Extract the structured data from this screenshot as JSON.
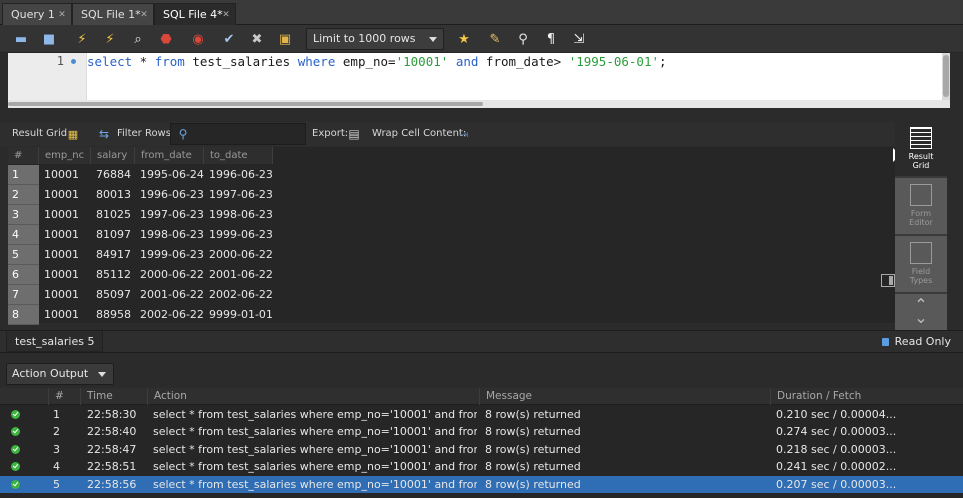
{
  "tabs": [
    {
      "label": "Query 1",
      "active": false
    },
    {
      "label": "SQL File 1*",
      "active": false
    },
    {
      "label": "SQL File 4*",
      "active": true
    }
  ],
  "toolbar": {
    "limit_label": "Limit to 1000 rows",
    "icons": [
      "open-folder-icon",
      "save-icon",
      "execute-lightning-icon",
      "execute-current-lightning-icon",
      "explain-icon",
      "stop-icon",
      "error-toggle-icon",
      "commit-icon",
      "rollback-icon",
      "autocommit-icon",
      "bookmark-star-icon",
      "beautify-brush-icon",
      "search-icon",
      "invisible-chars-icon",
      "wrap-icon"
    ]
  },
  "editor": {
    "line_number": "1",
    "tokens": [
      {
        "t": "select",
        "c": "kw"
      },
      {
        "t": " * ",
        "c": ""
      },
      {
        "t": "from",
        "c": "kw"
      },
      {
        "t": " test_salaries ",
        "c": ""
      },
      {
        "t": "where",
        "c": "kw"
      },
      {
        "t": " emp_no=",
        "c": ""
      },
      {
        "t": "'10001'",
        "c": "str"
      },
      {
        "t": " ",
        "c": ""
      },
      {
        "t": "and",
        "c": "kw"
      },
      {
        "t": " from_date> ",
        "c": ""
      },
      {
        "t": "'1995-06-01'",
        "c": "str"
      },
      {
        "t": ";",
        "c": ""
      }
    ]
  },
  "result_toolbar": {
    "result_grid": "Result Grid",
    "filter_rows": "Filter Rows:",
    "export": "Export:",
    "wrap": "Wrap Cell Content:"
  },
  "grid": {
    "columns": [
      "#",
      "emp_nc",
      "salary",
      "from_date",
      "to_date"
    ],
    "rows": [
      [
        "1",
        "10001",
        "76884",
        "1995-06-24",
        "1996-06-23"
      ],
      [
        "2",
        "10001",
        "80013",
        "1996-06-23",
        "1997-06-23"
      ],
      [
        "3",
        "10001",
        "81025",
        "1997-06-23",
        "1998-06-23"
      ],
      [
        "4",
        "10001",
        "81097",
        "1998-06-23",
        "1999-06-23"
      ],
      [
        "5",
        "10001",
        "84917",
        "1999-06-23",
        "2000-06-22"
      ],
      [
        "6",
        "10001",
        "85112",
        "2000-06-22",
        "2001-06-22"
      ],
      [
        "7",
        "10001",
        "85097",
        "2001-06-22",
        "2002-06-22"
      ],
      [
        "8",
        "10001",
        "88958",
        "2002-06-22",
        "9999-01-01"
      ]
    ]
  },
  "side_panel": {
    "result_grid": [
      "Result",
      "Grid"
    ],
    "form_editor": [
      "Form",
      "Editor"
    ],
    "field_types": [
      "Field",
      "Types"
    ]
  },
  "result_tab": "test_salaries 5",
  "read_only": "Read Only",
  "action_output": {
    "selector": "Action Output",
    "columns": [
      "#",
      "Time",
      "Action",
      "Message",
      "Duration / Fetch"
    ],
    "rows": [
      {
        "n": "1",
        "time": "22:58:30",
        "action": "select * from test_salaries where emp_no='10001' and from_d...",
        "message": "8 row(s) returned",
        "duration": "0.210 sec / 0.00004..."
      },
      {
        "n": "2",
        "time": "22:58:40",
        "action": "select * from test_salaries where emp_no='10001' and from_d...",
        "message": "8 row(s) returned",
        "duration": "0.274 sec / 0.00003..."
      },
      {
        "n": "3",
        "time": "22:58:47",
        "action": "select * from test_salaries where emp_no='10001' and from_d...",
        "message": "8 row(s) returned",
        "duration": "0.218 sec / 0.00003..."
      },
      {
        "n": "4",
        "time": "22:58:51",
        "action": "select * from test_salaries where emp_no='10001' and from_d...",
        "message": "8 row(s) returned",
        "duration": "0.241 sec / 0.00002..."
      },
      {
        "n": "5",
        "time": "22:58:56",
        "action": "select * from test_salaries where emp_no='10001' and from_d...",
        "message": "8 row(s) returned",
        "duration": "0.207 sec / 0.00003..."
      }
    ]
  }
}
